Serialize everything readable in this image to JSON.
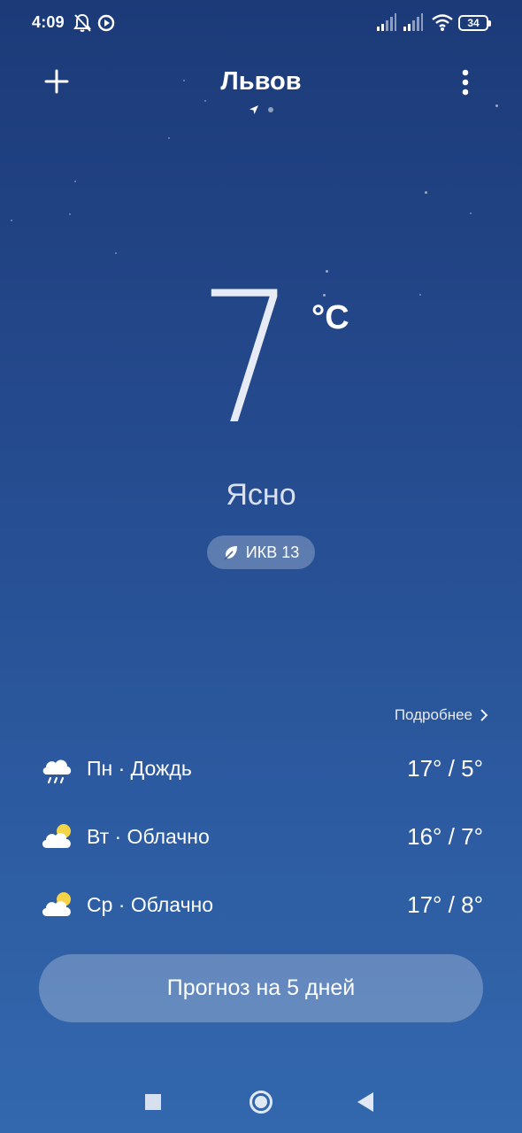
{
  "status_bar": {
    "time": "4:09",
    "battery": "34",
    "icons": [
      "bell-off-icon",
      "record-icon",
      "signal-icon",
      "signal-icon",
      "wifi-icon",
      "battery-icon"
    ]
  },
  "header": {
    "city": "Львов",
    "add_icon": "plus-icon",
    "more_icon": "more-vertical-icon",
    "pager": {
      "pages": 2,
      "current": 1,
      "current_indicator": "location-arrow-icon"
    }
  },
  "current": {
    "temperature": "7",
    "unit": "°C",
    "condition": "Ясно",
    "aqi_label": "ИКВ 13",
    "aqi_icon": "leaf-icon"
  },
  "forecast": {
    "more_label": "Подробнее",
    "days": [
      {
        "label": "Пн · Дождь",
        "range": "17° / 5°",
        "icon": "rain-cloud-icon"
      },
      {
        "label": "Вт · Облачно",
        "range": "16° / 7°",
        "icon": "partly-cloudy-icon"
      },
      {
        "label": "Ср · Облачно",
        "range": "17° / 8°",
        "icon": "partly-cloudy-icon"
      }
    ],
    "button_label": "Прогноз на 5 дней"
  },
  "navbar": {
    "icons": [
      "recents-square-icon",
      "home-circle-icon",
      "back-triangle-icon"
    ]
  },
  "colors": {
    "background_top": "#1c3a78",
    "background_bottom": "#3368ae",
    "sun": "#f5d547"
  }
}
